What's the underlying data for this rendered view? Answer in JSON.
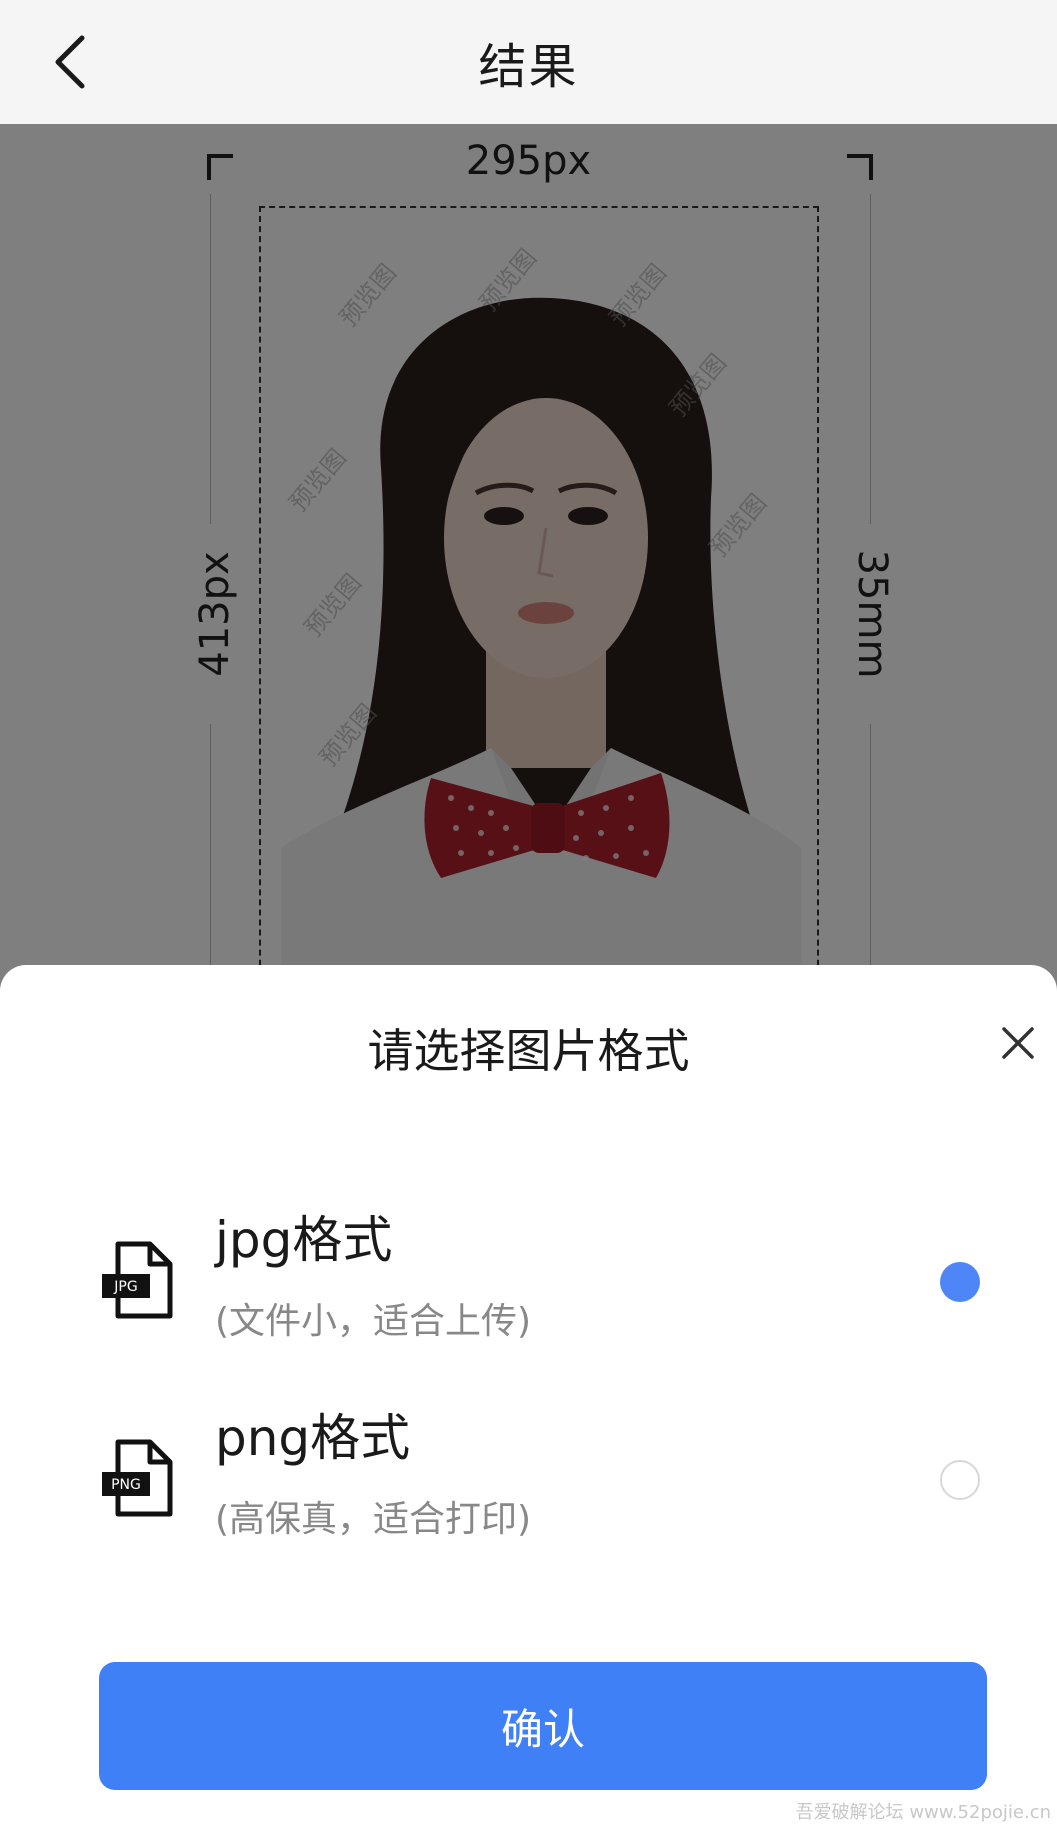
{
  "header": {
    "title": "结果",
    "back_icon": "chevron-left-icon"
  },
  "preview": {
    "width_label": "295px",
    "height_label": "413px",
    "size_label": "35mm",
    "watermark_text": "预览图"
  },
  "sheet": {
    "title": "请选择图片格式",
    "close_icon": "close-icon",
    "options": [
      {
        "name": "jpg格式",
        "desc": "(文件小，适合上传)",
        "icon_text": "JPG",
        "selected": true
      },
      {
        "name": "png格式",
        "desc": "(高保真，适合打印)",
        "icon_text": "PNG",
        "selected": false
      }
    ],
    "confirm_label": "确认"
  },
  "colors": {
    "accent": "#4080f6",
    "radio_on": "#4e86f7"
  },
  "footer_watermark": "吾爱破解论坛 www.52pojie.cn"
}
